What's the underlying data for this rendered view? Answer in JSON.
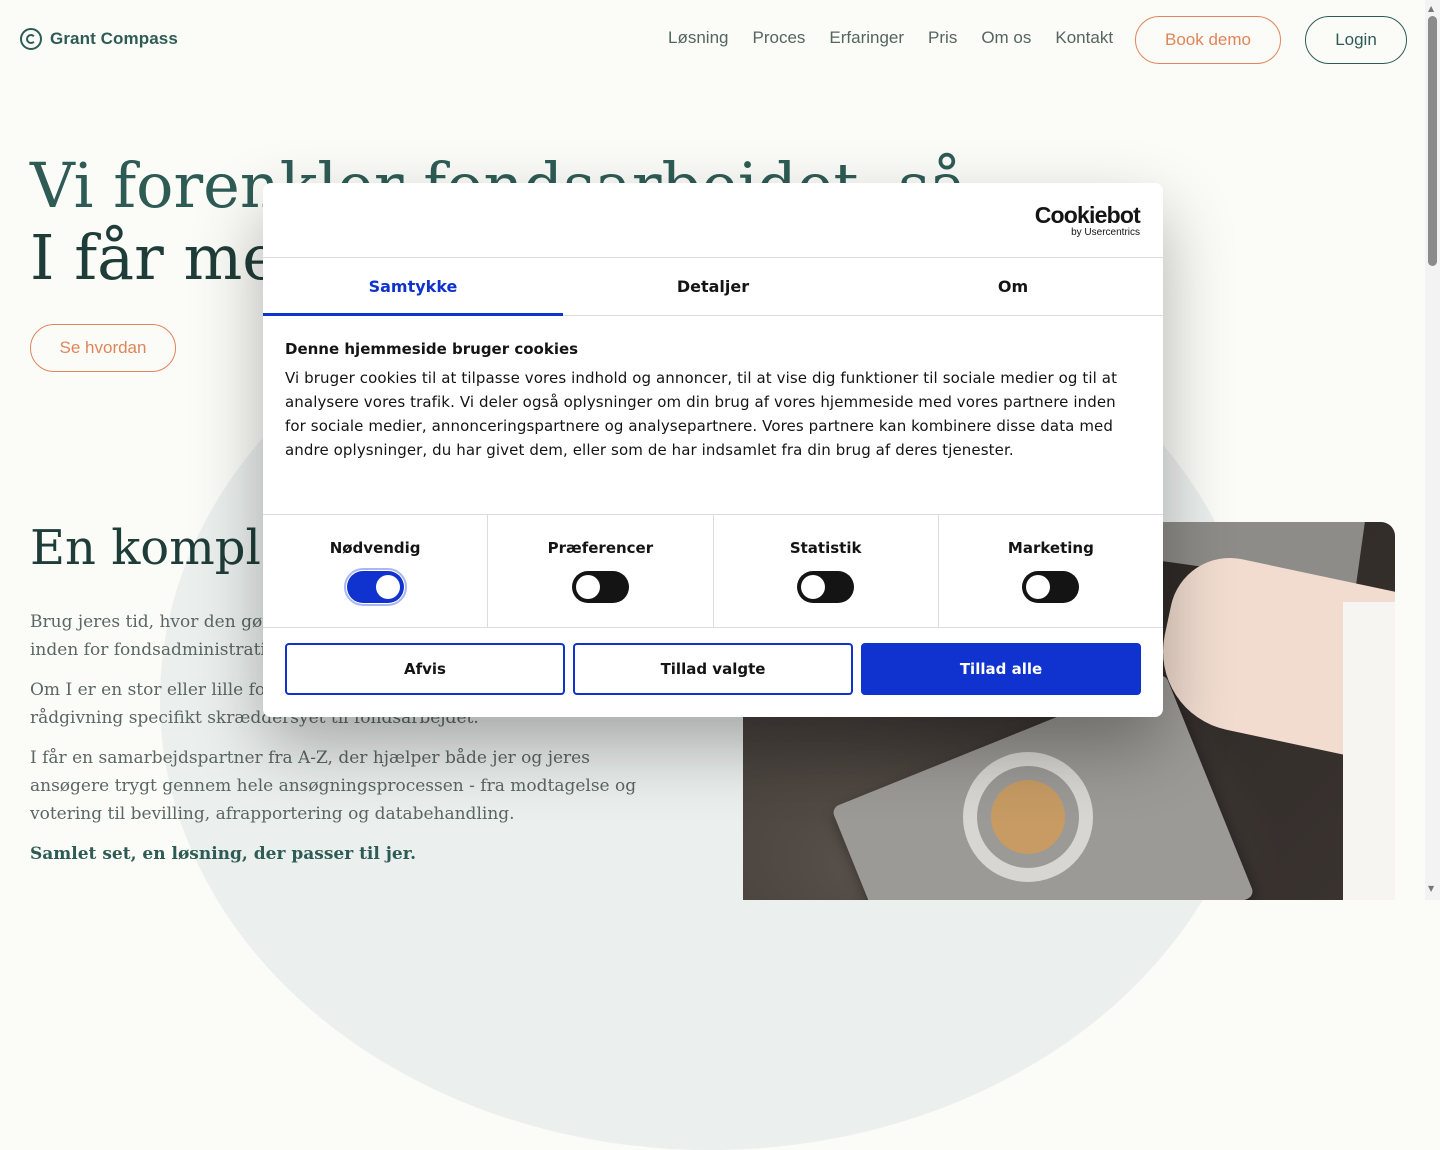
{
  "header": {
    "logo_text": "Grant Compass",
    "nav": [
      "Løsning",
      "Proces",
      "Erfaringer",
      "Pris",
      "Om os",
      "Kontakt"
    ],
    "book_demo": "Book demo",
    "login": "Login"
  },
  "hero": {
    "title_line1": "Vi forenkler fondsarbejdet, så",
    "title_line2": "I får mere tid til det vigtigste",
    "cta": "Se hvordan"
  },
  "section": {
    "title": "En komplet løsning til fondsarbejdet",
    "paragraphs": [
      "Brug jeres tid, hvor den gør den største forskel - med vores ekspertise inden for fondsadministration.",
      "Om I er en stor eller lille fond, en ny eller erfaren, er vores værktøjer og rådgivning specifikt skræddersyet til fondsarbejdet.",
      "I får en samarbejdspartner fra A-Z, der hjælper både jer og jeres ansøgere trygt gennem hele ansøgningsprocessen - fra modtagelse og votering til bevilling, afrapportering og databehandling."
    ],
    "closing": "Samlet set, en løsning, der passer til jer."
  },
  "cookie_dialog": {
    "brand": "Cookiebot",
    "brand_sub": "by Usercentrics",
    "tabs": [
      {
        "label": "Samtykke",
        "active": true
      },
      {
        "label": "Detaljer",
        "active": false
      },
      {
        "label": "Om",
        "active": false
      }
    ],
    "title": "Denne hjemmeside bruger cookies",
    "text": "Vi bruger cookies til at tilpasse vores indhold og annoncer, til at vise dig funktioner til sociale medier og til at analysere vores trafik. Vi deler også oplysninger om din brug af vores hjemmeside med vores partnere inden for sociale medier, annonceringspartnere og analysepartnere. Vores partnere kan kombinere disse data med andre oplysninger, du har givet dem, eller som de har indsamlet fra din brug af deres tjenester.",
    "categories": [
      {
        "label": "Nødvendig",
        "enabled": true
      },
      {
        "label": "Præferencer",
        "enabled": false
      },
      {
        "label": "Statistik",
        "enabled": false
      },
      {
        "label": "Marketing",
        "enabled": false
      }
    ],
    "buttons": {
      "reject": "Afvis",
      "allow_selected": "Tillad valgte",
      "allow_all": "Tillad alle"
    },
    "accent_color": "#1032cf"
  },
  "colors": {
    "brand_green": "#2e5c55",
    "accent_orange": "#e0855a",
    "background": "#fbfbf8"
  },
  "icons": {
    "logo": "compass-logo-icon",
    "scroll_up": "scroll-up-arrow-icon",
    "scroll_down": "scroll-down-arrow-icon"
  }
}
